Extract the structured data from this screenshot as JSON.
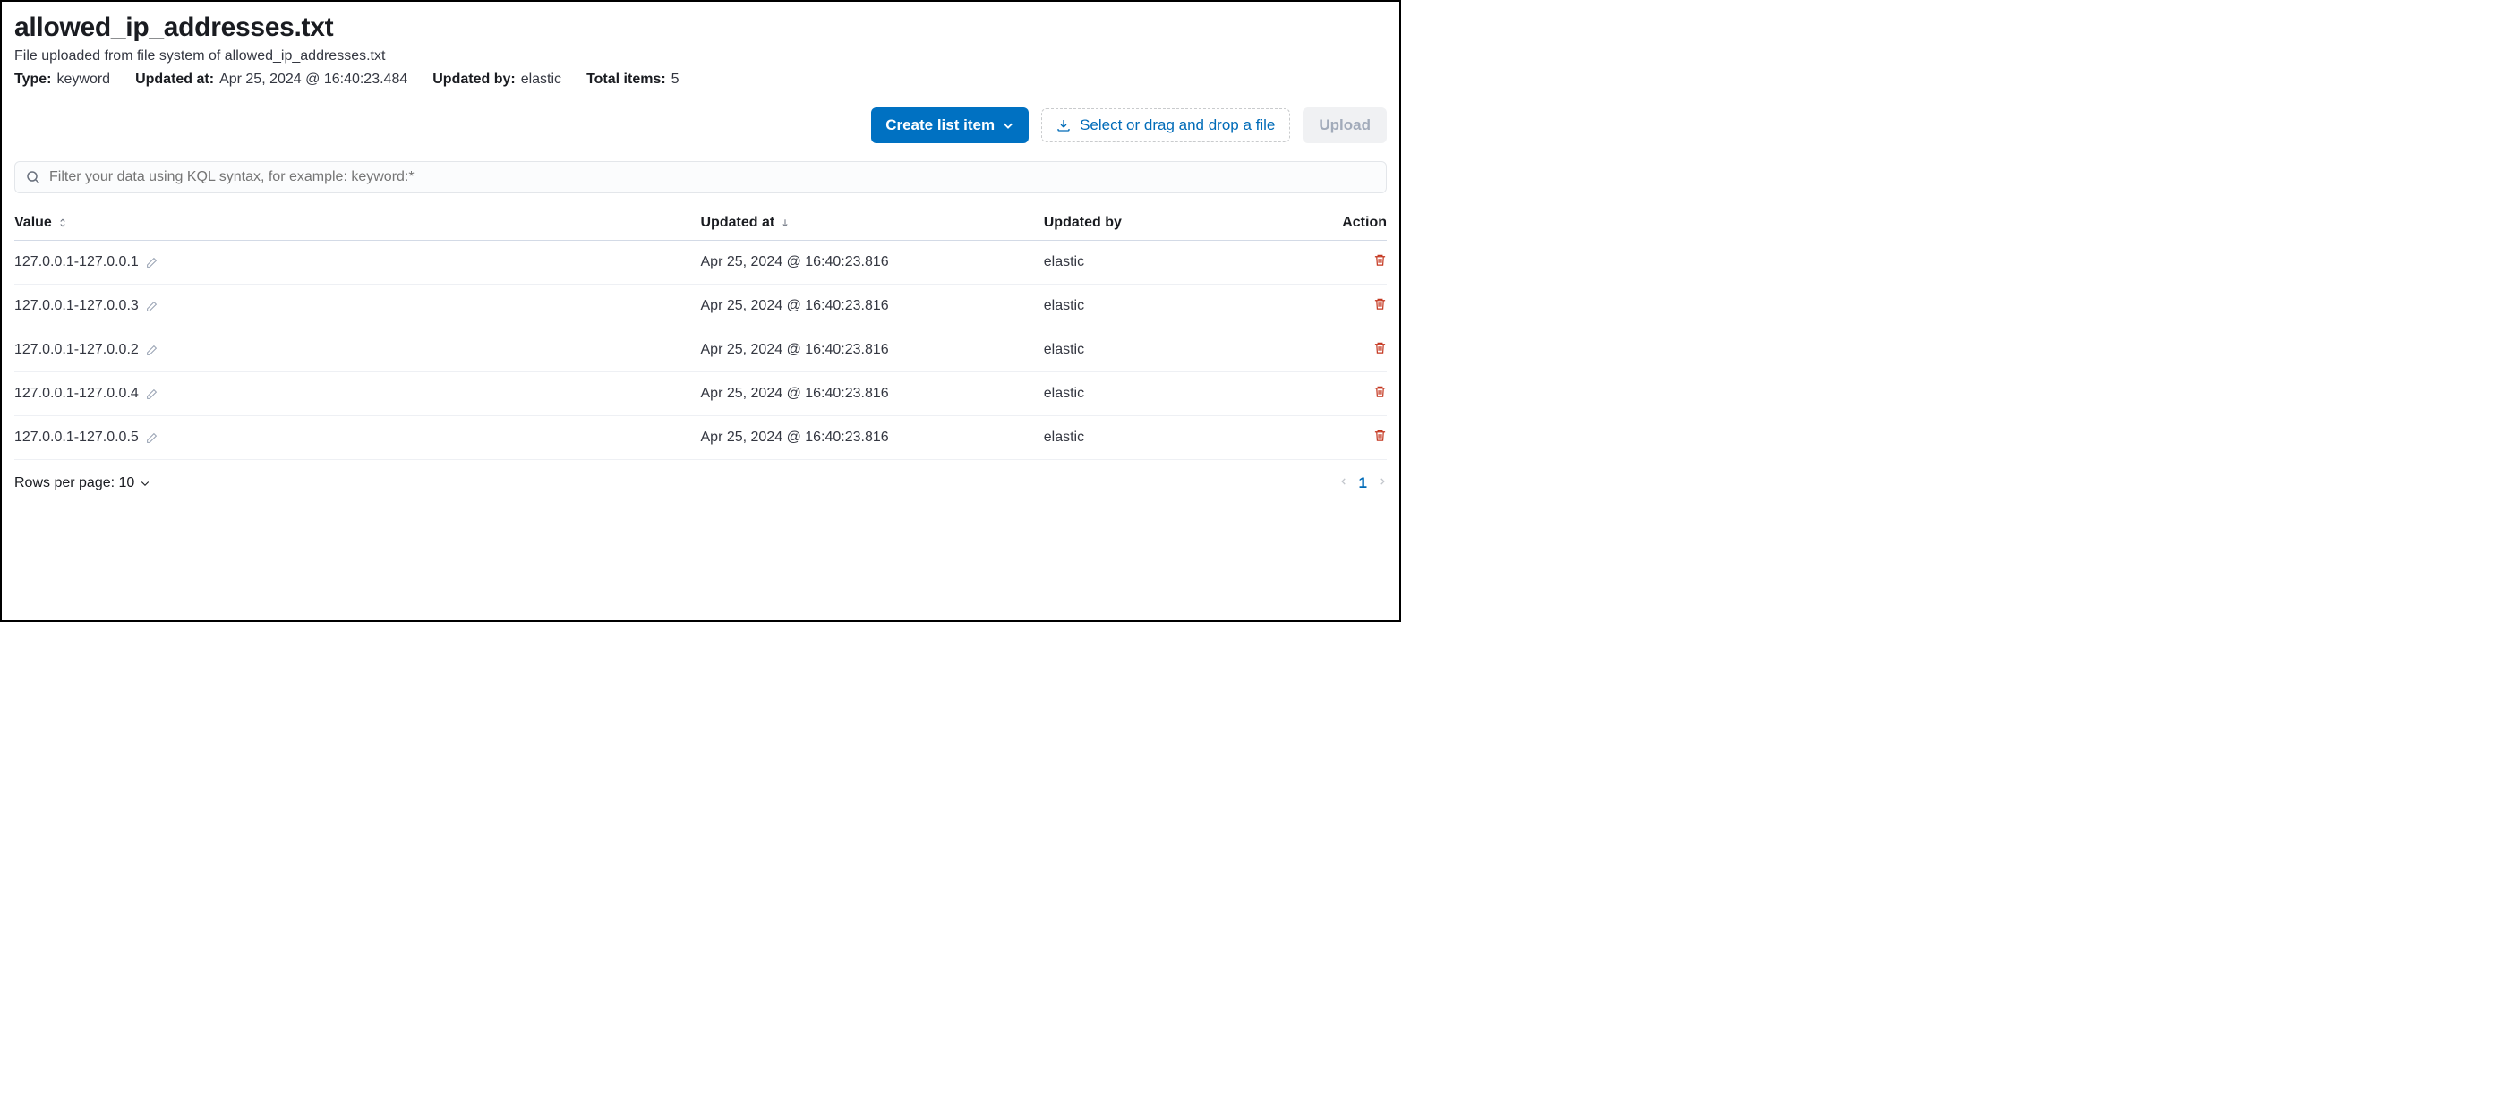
{
  "header": {
    "title": "allowed_ip_addresses.txt",
    "subtitle": "File uploaded from file system of allowed_ip_addresses.txt",
    "meta": {
      "type_label": "Type:",
      "type_value": "keyword",
      "updated_at_label": "Updated at:",
      "updated_at_value": "Apr 25, 2024 @ 16:40:23.484",
      "updated_by_label": "Updated by:",
      "updated_by_value": "elastic",
      "total_items_label": "Total items:",
      "total_items_value": "5"
    }
  },
  "actions": {
    "create_label": "Create list item",
    "file_drop_label": "Select or drag and drop a file",
    "upload_label": "Upload"
  },
  "search": {
    "placeholder": "Filter your data using KQL syntax, for example: keyword:*"
  },
  "table": {
    "columns": {
      "value": "Value",
      "updated_at": "Updated at",
      "updated_by": "Updated by",
      "action": "Action"
    },
    "rows": [
      {
        "value": "127.0.0.1-127.0.0.1",
        "updated_at": "Apr 25, 2024 @ 16:40:23.816",
        "updated_by": "elastic"
      },
      {
        "value": "127.0.0.1-127.0.0.3",
        "updated_at": "Apr 25, 2024 @ 16:40:23.816",
        "updated_by": "elastic"
      },
      {
        "value": "127.0.0.1-127.0.0.2",
        "updated_at": "Apr 25, 2024 @ 16:40:23.816",
        "updated_by": "elastic"
      },
      {
        "value": "127.0.0.1-127.0.0.4",
        "updated_at": "Apr 25, 2024 @ 16:40:23.816",
        "updated_by": "elastic"
      },
      {
        "value": "127.0.0.1-127.0.0.5",
        "updated_at": "Apr 25, 2024 @ 16:40:23.816",
        "updated_by": "elastic"
      }
    ]
  },
  "footer": {
    "rows_per_page_label": "Rows per page: 10",
    "current_page": "1"
  }
}
